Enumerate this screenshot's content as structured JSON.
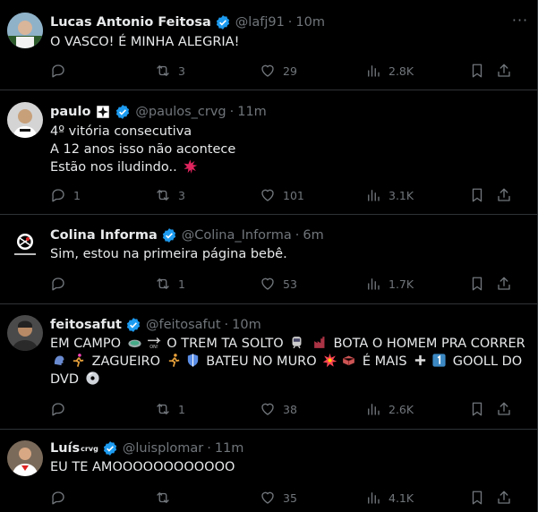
{
  "tweets": [
    {
      "name": "Lucas Antonio Feitosa",
      "handle": "@lafj91",
      "time": "10m",
      "lines": [
        "O VASCO! É MINHA ALEGRIA!"
      ],
      "replies": "",
      "retweets": "3",
      "likes": "29",
      "views": "2.8K"
    },
    {
      "name": "paulo",
      "handle": "@paulos_crvg",
      "time": "11m",
      "lines": [
        "4º vitória consecutiva",
        "A 12 anos isso não acontece",
        "Estão nos iludindo.."
      ],
      "replies": "1",
      "retweets": "3",
      "likes": "101",
      "views": "3.1K"
    },
    {
      "name": "Colina Informa",
      "handle": "@Colina_Informa",
      "time": "6m",
      "lines": [
        "Sim, estou na primeira página bebê."
      ],
      "replies": "",
      "retweets": "1",
      "likes": "53",
      "views": "1.7K"
    },
    {
      "name": "feitosafut",
      "handle": "@feitosafut",
      "time": "10m",
      "lines": [
        "EM CAMPO",
        "O TREM TA SOLTO",
        "BOTA O HOMEM PRA CORRER",
        "ZAGUEIRO",
        "BATEU NO MURO",
        "É MAIS",
        "GOOLL DO",
        "DVD"
      ],
      "replies": "",
      "retweets": "1",
      "likes": "38",
      "views": "2.6K"
    },
    {
      "name": "Luís",
      "name_suffix": "crvg",
      "handle": "@luisplomar",
      "time": "11m",
      "lines": [
        "EU TE AMOOOOOOOOOOOO"
      ],
      "replies": "",
      "retweets": "",
      "likes": "35",
      "views": "4.1K"
    }
  ],
  "icons": {
    "reply": "reply-icon",
    "retweet": "retweet-icon",
    "like": "like-icon",
    "views": "views-icon",
    "bookmark": "bookmark-icon",
    "share": "share-icon",
    "verified": "verified-badge-icon",
    "more": "more-icon"
  },
  "colors": {
    "background": "#000000",
    "text": "#e7e9ea",
    "muted": "#71767b",
    "divider": "#2f3336",
    "verified": "#1d9bf0"
  }
}
